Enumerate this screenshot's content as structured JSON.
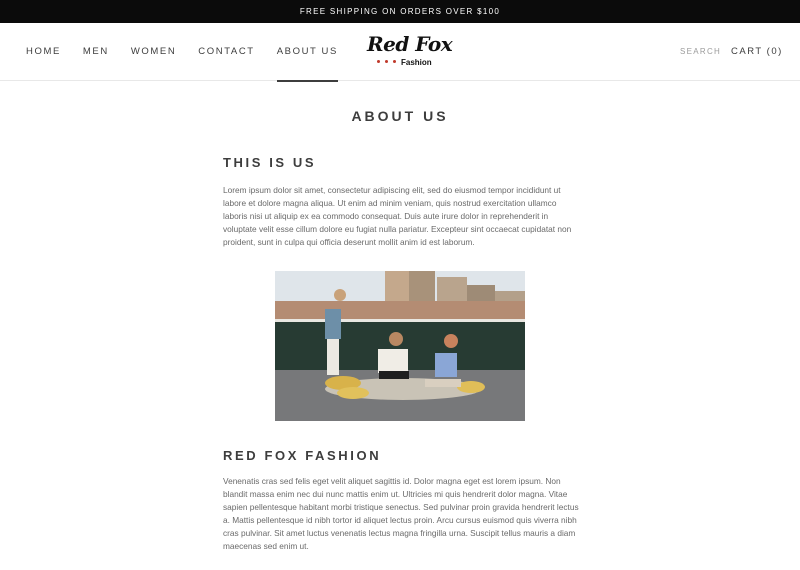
{
  "announcement": {
    "text": "FREE SHIPPING ON ORDERS OVER $100"
  },
  "nav": {
    "items": [
      {
        "label": "HOME",
        "active": false
      },
      {
        "label": "MEN",
        "active": false
      },
      {
        "label": "WOMEN",
        "active": false
      },
      {
        "label": "CONTACT",
        "active": false
      },
      {
        "label": "ABOUT US",
        "active": true
      }
    ]
  },
  "logo": {
    "script": "Red Fox",
    "sub": "Fashion"
  },
  "header": {
    "search_label": "SEARCH",
    "cart_label": "CART (0)"
  },
  "page": {
    "title": "ABOUT US",
    "sections": [
      {
        "heading": "THIS IS US",
        "text": "Lorem ipsum dolor sit amet, consectetur adipiscing elit, sed do eiusmod tempor incididunt ut labore et dolore magna aliqua. Ut enim ad minim veniam, quis nostrud exercitation ullamco laboris nisi ut aliquip ex ea commodo consequat. Duis aute irure dolor in reprehenderit in voluptate velit esse cillum dolore eu fugiat nulla pariatur. Excepteur sint occaecat cupidatat non proident, sunt in culpa qui officia deserunt mollit anim id est laborum."
      },
      {
        "heading": "RED FOX FASHION",
        "text": "Venenatis cras sed felis eget velit aliquet sagittis id. Dolor magna eget est lorem ipsum. Non blandit massa enim nec dui nunc mattis enim ut. Ultricies mi quis hendrerit dolor magna. Vitae sapien pellentesque habitant morbi tristique senectus. Sed pulvinar proin gravida hendrerit lectus a. Mattis pellentesque id nibh tortor id aliquet lectus proin. Arcu cursus euismod quis viverra nibh cras pulvinar. Sit amet luctus venenatis lectus magna fringilla urna. Suscipit tellus mauris a diam maecenas sed enim ut."
      }
    ]
  },
  "colors": {
    "announcement_bg": "#0b0b0b",
    "text": "#3d3d3d",
    "logo_dots": "#c0392b"
  }
}
